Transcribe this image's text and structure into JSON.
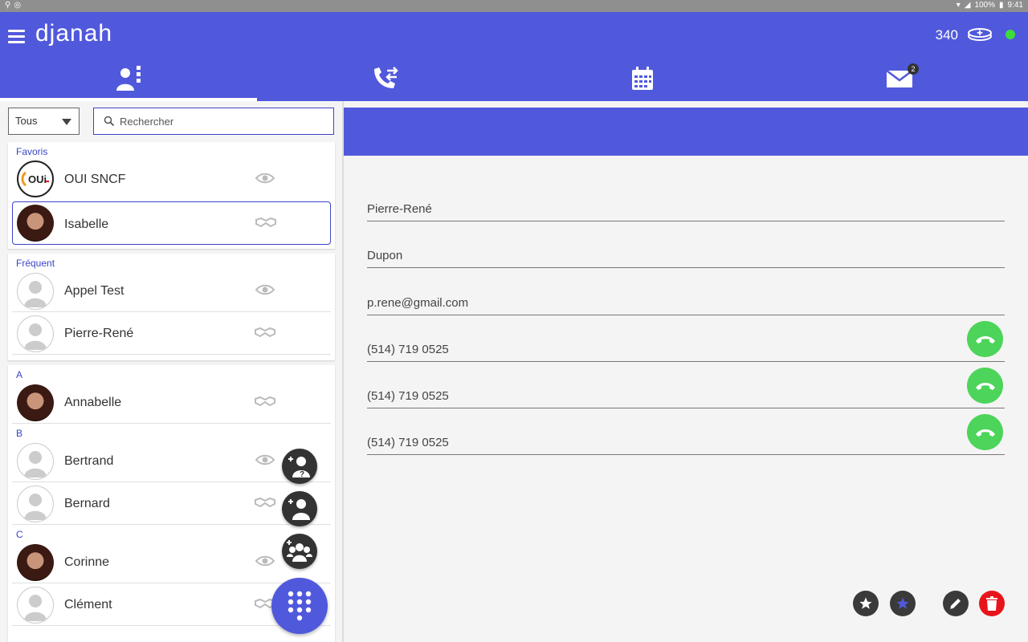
{
  "status_bar": {
    "battery": "100%",
    "time": "9:41"
  },
  "app": {
    "logo": "djanah",
    "credits": "340"
  },
  "tabs": [
    {
      "name": "contacts",
      "icon": "contacts-icon",
      "badge": ""
    },
    {
      "name": "calls",
      "icon": "call-transfer-icon",
      "badge": ""
    },
    {
      "name": "calendar",
      "icon": "calendar-icon",
      "badge": ""
    },
    {
      "name": "messages",
      "icon": "mail-icon",
      "badge": "2"
    }
  ],
  "filter": {
    "selected": "Tous"
  },
  "search": {
    "placeholder": "Rechercher"
  },
  "sections": {
    "favorites": "Favoris",
    "frequent": "Fréquent",
    "a": "A",
    "b": "B",
    "c": "C"
  },
  "contacts": {
    "oui_sncf": {
      "name": "OUI SNCF",
      "status": "eye-icon"
    },
    "isabelle": {
      "name": "Isabelle",
      "status": "handshake-icon"
    },
    "appel_test": {
      "name": "Appel Test",
      "status": "eye-icon"
    },
    "pierre_rene": {
      "name": "Pierre-René",
      "status": "handshake-icon"
    },
    "annabelle": {
      "name": "Annabelle",
      "status": "handshake-icon"
    },
    "bertrand": {
      "name": "Bertrand",
      "status": "eye-icon"
    },
    "bernard": {
      "name": "Bernard",
      "status": "handshake-icon"
    },
    "corinne": {
      "name": "Corinne",
      "status": "eye-icon"
    },
    "clement": {
      "name": "Clément",
      "status": "handshake-icon"
    }
  },
  "oui_logo_text": "OUi",
  "detail": {
    "first_name": "Pierre-René",
    "last_name": "Dupon",
    "email": "p.rene@gmail.com",
    "phones": [
      "(514) 719 0525",
      "(514) 719 0525",
      "(514) 719 0525"
    ]
  },
  "colors": {
    "primary": "#5059dc",
    "call_green": "#4dd45a",
    "delete_red": "#e8141b",
    "online": "#3ddc3a"
  }
}
